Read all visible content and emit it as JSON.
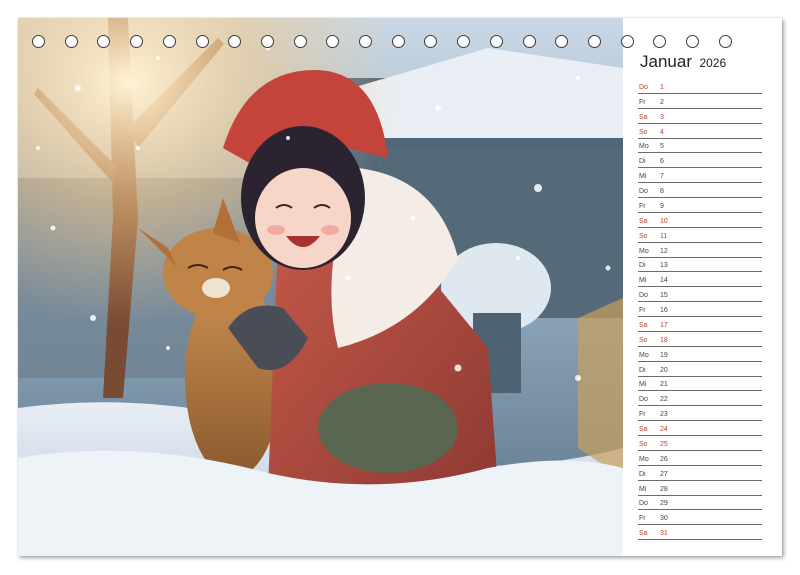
{
  "calendar": {
    "month": "Januar",
    "year": "2026",
    "ring_count": 22,
    "highlight_color": "#b5402f",
    "days": [
      {
        "weekday": "Do",
        "day": "1",
        "red": true
      },
      {
        "weekday": "Fr",
        "day": "2",
        "red": false
      },
      {
        "weekday": "Sa",
        "day": "3",
        "red": true
      },
      {
        "weekday": "So",
        "day": "4",
        "red": true
      },
      {
        "weekday": "Mo",
        "day": "5",
        "red": false
      },
      {
        "weekday": "Di",
        "day": "6",
        "red": false
      },
      {
        "weekday": "Mi",
        "day": "7",
        "red": false
      },
      {
        "weekday": "Do",
        "day": "8",
        "red": false
      },
      {
        "weekday": "Fr",
        "day": "9",
        "red": false
      },
      {
        "weekday": "Sa",
        "day": "10",
        "red": true
      },
      {
        "weekday": "So",
        "day": "11",
        "red": true
      },
      {
        "weekday": "Mo",
        "day": "12",
        "red": false
      },
      {
        "weekday": "Di",
        "day": "13",
        "red": false
      },
      {
        "weekday": "Mi",
        "day": "14",
        "red": false
      },
      {
        "weekday": "Do",
        "day": "15",
        "red": false
      },
      {
        "weekday": "Fr",
        "day": "16",
        "red": false
      },
      {
        "weekday": "Sa",
        "day": "17",
        "red": true
      },
      {
        "weekday": "So",
        "day": "18",
        "red": true
      },
      {
        "weekday": "Mo",
        "day": "19",
        "red": false
      },
      {
        "weekday": "Di",
        "day": "20",
        "red": false
      },
      {
        "weekday": "Mi",
        "day": "21",
        "red": false
      },
      {
        "weekday": "Do",
        "day": "22",
        "red": false
      },
      {
        "weekday": "Fr",
        "day": "23",
        "red": false
      },
      {
        "weekday": "Sa",
        "day": "24",
        "red": true
      },
      {
        "weekday": "So",
        "day": "25",
        "red": true
      },
      {
        "weekday": "Mo",
        "day": "26",
        "red": false
      },
      {
        "weekday": "Di",
        "day": "27",
        "red": false
      },
      {
        "weekday": "Mi",
        "day": "28",
        "red": false
      },
      {
        "weekday": "Do",
        "day": "29",
        "red": false
      },
      {
        "weekday": "Fr",
        "day": "30",
        "red": false
      },
      {
        "weekday": "Sa",
        "day": "31",
        "red": true
      }
    ]
  },
  "photo": {
    "subject": "girl-hugging-cat-in-snow"
  }
}
